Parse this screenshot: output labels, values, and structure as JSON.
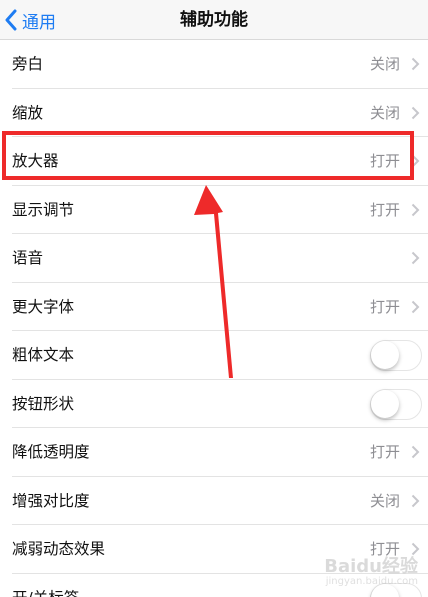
{
  "nav": {
    "back_label": "通用",
    "title": "辅助功能"
  },
  "rows": [
    {
      "label": "旁白",
      "value": "关闭"
    },
    {
      "label": "缩放",
      "value": "关闭"
    },
    {
      "label": "放大器",
      "value": "打开"
    },
    {
      "label": "显示调节",
      "value": "打开"
    },
    {
      "label": "语音",
      "value": ""
    },
    {
      "label": "更大字体",
      "value": "打开"
    },
    {
      "label": "粗体文本",
      "toggle": false
    },
    {
      "label": "按钮形状",
      "toggle": false
    },
    {
      "label": "降低透明度",
      "value": "打开"
    },
    {
      "label": "增强对比度",
      "value": "关闭"
    },
    {
      "label": "减弱动态效果",
      "value": "打开"
    },
    {
      "label": "开/关标签",
      "toggle": false
    }
  ],
  "annotation": {
    "color": "#ee2a2a"
  },
  "watermark": {
    "text": "Baidu经验",
    "sub": "jingyan.baidu.com"
  },
  "colors": {
    "accent": "#1e7cf2",
    "secondary_text": "#8e8e93",
    "separator": "#e3e3e3"
  }
}
